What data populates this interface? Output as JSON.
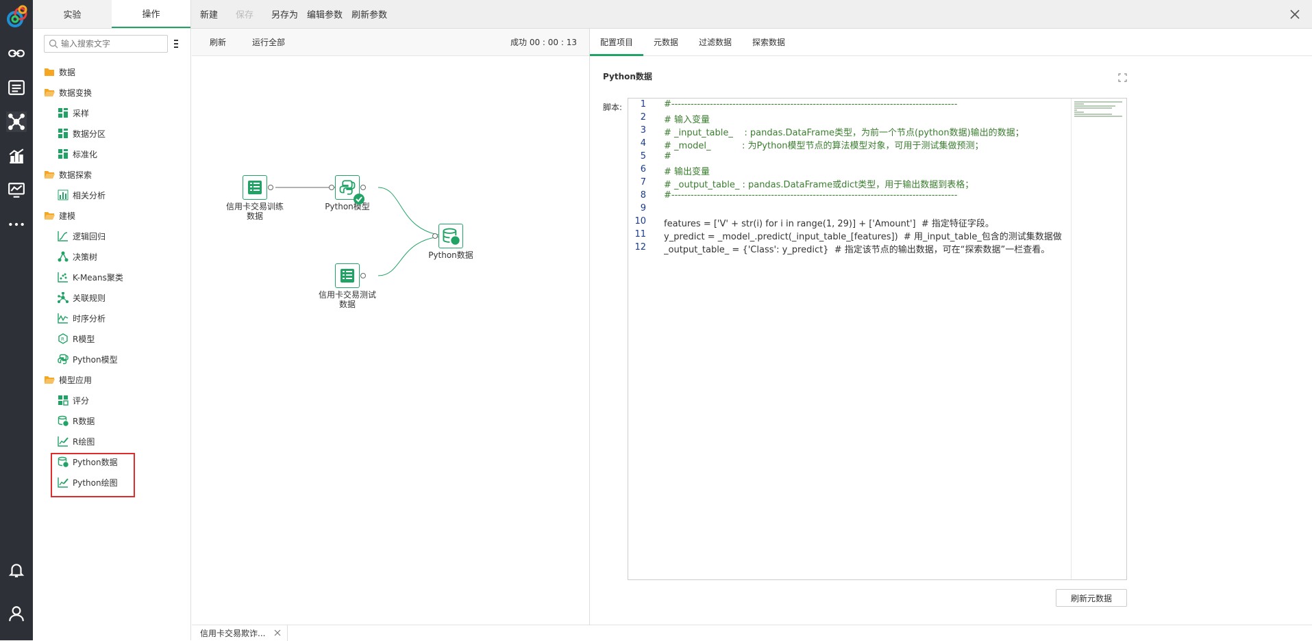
{
  "sidebar_tabs": [
    {
      "label": "实验"
    },
    {
      "label": "操作"
    }
  ],
  "search": {
    "placeholder": "输入搜索文字"
  },
  "tree": [
    {
      "type": "folder",
      "label": "数据"
    },
    {
      "type": "folder",
      "label": "数据变换"
    },
    {
      "type": "leaf",
      "label": "采样",
      "icon": "grid-icon"
    },
    {
      "type": "leaf",
      "label": "数据分区",
      "icon": "grid-icon"
    },
    {
      "type": "leaf",
      "label": "标准化",
      "icon": "grid-icon"
    },
    {
      "type": "folder",
      "label": "数据探索"
    },
    {
      "type": "leaf",
      "label": "相关分析",
      "icon": "bar-icon"
    },
    {
      "type": "folder",
      "label": "建模"
    },
    {
      "type": "leaf",
      "label": "逻辑回归",
      "icon": "curve-icon"
    },
    {
      "type": "leaf",
      "label": "决策树",
      "icon": "tree-icon"
    },
    {
      "type": "leaf",
      "label": "K-Means聚类",
      "icon": "scatter-icon"
    },
    {
      "type": "leaf",
      "label": "关联规则",
      "icon": "network-icon"
    },
    {
      "type": "leaf",
      "label": "时序分析",
      "icon": "timeseries-icon"
    },
    {
      "type": "leaf",
      "label": "R模型",
      "icon": "r-model-icon"
    },
    {
      "type": "leaf",
      "label": "Python模型",
      "icon": "python-icon"
    },
    {
      "type": "folder",
      "label": "模型应用"
    },
    {
      "type": "leaf",
      "label": "评分",
      "icon": "score-icon"
    },
    {
      "type": "leaf",
      "label": "R数据",
      "icon": "database-icon"
    },
    {
      "type": "leaf",
      "label": "R绘图",
      "icon": "chart-edit-icon"
    },
    {
      "type": "leaf",
      "label": "Python数据",
      "icon": "database-icon"
    },
    {
      "type": "leaf",
      "label": "Python绘图",
      "icon": "chart-edit-icon"
    }
  ],
  "topbar": {
    "new": "新建",
    "save": "保存",
    "save_as": "另存为",
    "edit_params": "编辑参数",
    "refresh_params": "刷新参数"
  },
  "canvas_bar": {
    "refresh": "刷新",
    "run_all": "运行全部",
    "status": "成功 00 : 00 : 13"
  },
  "nodes": {
    "train": "信用卡交易训练数据",
    "model": "Python模型",
    "test": "信用卡交易测试数据",
    "output": "Python数据"
  },
  "right_tabs": [
    {
      "label": "配置项目"
    },
    {
      "label": "元数据"
    },
    {
      "label": "过滤数据"
    },
    {
      "label": "探索数据"
    }
  ],
  "panel": {
    "title": "Python数据",
    "script_label": "脚本:",
    "refresh_button": "刷新元数据"
  },
  "code_lines": [
    "#-----------------------------------------------------------------------------------------",
    "# 输入变量",
    "# _input_table_    : pandas.DataFrame类型，为前一个节点(python数据)输出的数据；",
    "# _model_           : 为Python模型节点的算法模型对象，可用于测试集做预测；",
    "#",
    "# 输出变量",
    "# _output_table_ : pandas.DataFrame或dict类型，用于输出数据到表格；",
    "#-----------------------------------------------------------------------------------------",
    "",
    "features = ['V' + str(i) for i in range(1, 29)] + ['Amount']  # 指定特征字段。",
    "y_predict = _model_.predict(_input_table_[features])  # 用_input_table_包含的测试集数据做",
    "_output_table_ = {'Class': y_predict}  # 指定该节点的输出数据，可在“探索数据”一栏查看。"
  ],
  "bottom_tab": {
    "label": "信用卡交易欺诈..."
  },
  "colors": {
    "accent": "#21a366",
    "highlight": "#e02b2b",
    "rail": "#2d3036"
  }
}
